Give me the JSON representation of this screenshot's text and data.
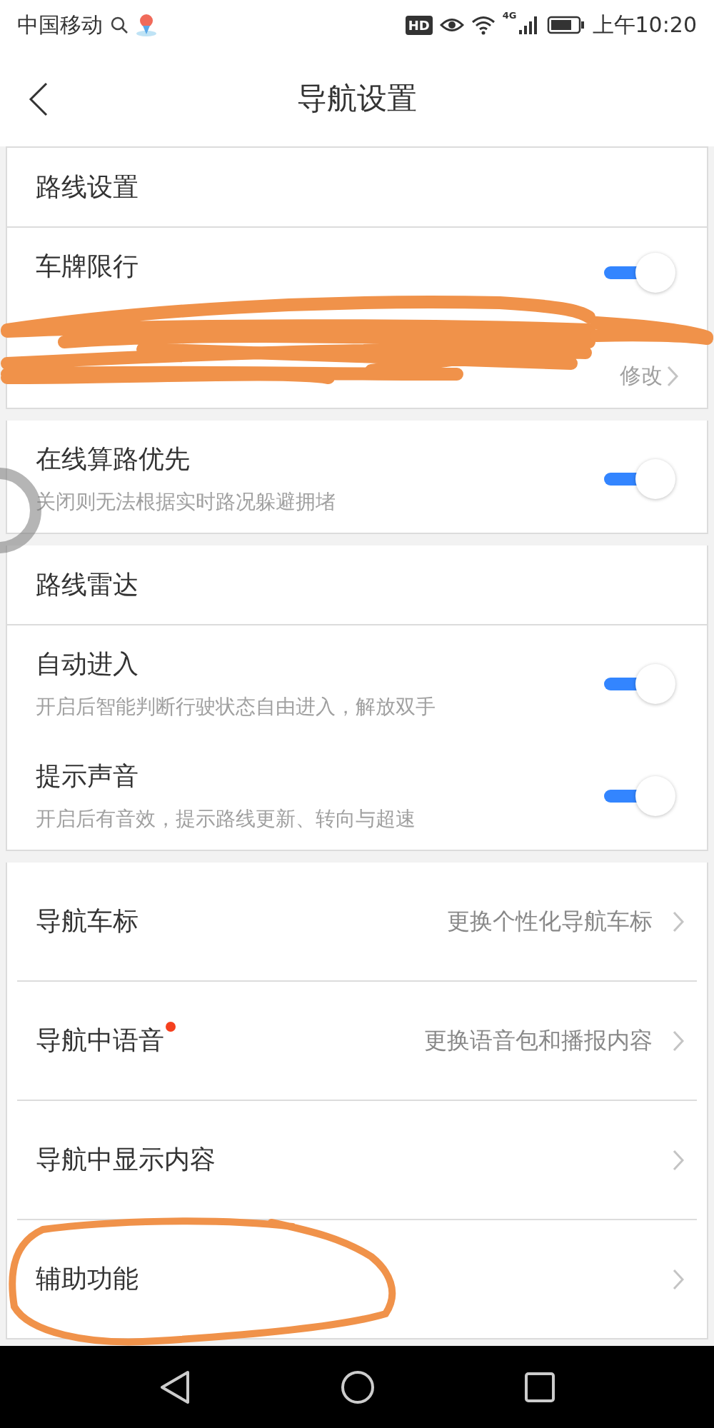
{
  "status_bar": {
    "carrier": "中国移动",
    "hd_badge": "HD",
    "network": "4G",
    "time": "上午10:20"
  },
  "header": {
    "title": "导航设置"
  },
  "sections": [
    {
      "title": "路线设置",
      "items": [
        {
          "kind": "toggle",
          "title": "车牌限行",
          "on": true,
          "action": "修改"
        }
      ]
    },
    {
      "items": [
        {
          "kind": "toggle",
          "title": "在线算路优先",
          "subtitle": "关闭则无法根据实时路况躲避拥堵",
          "on": true
        }
      ]
    },
    {
      "title": "路线雷达",
      "items": [
        {
          "kind": "toggle",
          "title": "自动进入",
          "subtitle": "开启后智能判断行驶状态自由进入，解放双手",
          "on": true
        },
        {
          "kind": "toggle",
          "title": "提示声音",
          "subtitle": "开启后有音效，提示路线更新、转向与超速",
          "on": true
        }
      ]
    },
    {
      "items": [
        {
          "kind": "link",
          "title": "导航车标",
          "value": "更换个性化导航车标",
          "dot": false
        },
        {
          "kind": "link",
          "title": "导航中语音",
          "value": "更换语音包和播报内容",
          "dot": true
        },
        {
          "kind": "link",
          "title": "导航中显示内容",
          "dot": false
        },
        {
          "kind": "link",
          "title": "辅助功能",
          "dot": false
        }
      ]
    }
  ]
}
